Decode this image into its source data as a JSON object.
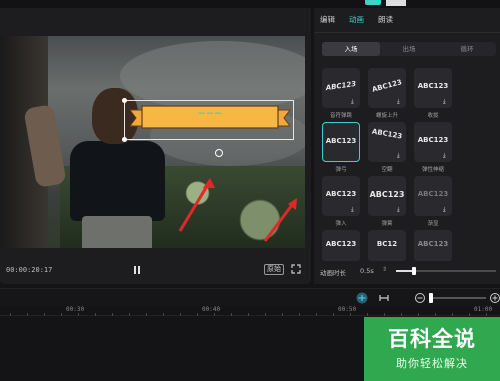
{
  "player": {
    "time": "00:00:20:17",
    "ratio_label": "原始"
  },
  "panel": {
    "tabs": [
      {
        "label": "编辑"
      },
      {
        "label": "动画"
      },
      {
        "label": "朗读"
      }
    ],
    "subtabs": [
      {
        "label": "入场"
      },
      {
        "label": "出场"
      },
      {
        "label": "循环"
      }
    ],
    "presets": [
      {
        "text": "ABC123",
        "label": "音符弹跳"
      },
      {
        "text": "ABC123",
        "label": "螺旋上升"
      },
      {
        "text": "ABC123",
        "label": "收拢"
      },
      {
        "text": "ABC123",
        "label": "弹弓"
      },
      {
        "text": "ABC123",
        "label": "空翻"
      },
      {
        "text": "ABC123",
        "label": "弹性伸缩"
      },
      {
        "text": "ABC123",
        "label": "弹入"
      },
      {
        "text": "ABC123",
        "label": "弹簧"
      },
      {
        "text": "ABC123",
        "label": "渐显"
      },
      {
        "text": "ABC123",
        "label": ""
      },
      {
        "text": "BC12",
        "label": ""
      },
      {
        "text": "ABC123",
        "label": ""
      }
    ],
    "duration_label": "动画时长",
    "duration_value": "0.5s",
    "duration_fraction": 0.18
  },
  "timeline": {
    "ticks": [
      "00:30",
      "00:40",
      "00:50",
      "01:00"
    ]
  },
  "watermark": {
    "title": "百科全说",
    "subtitle": "助你轻松解决"
  },
  "colors": {
    "accent": "#3fd1c9",
    "banner": "#f2a93b"
  }
}
